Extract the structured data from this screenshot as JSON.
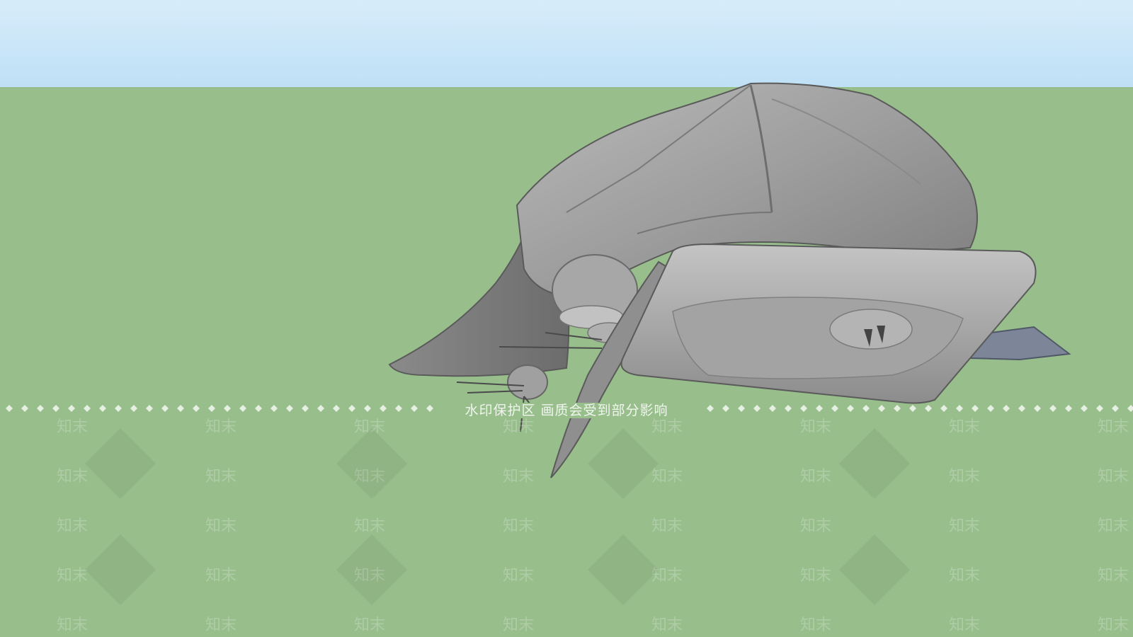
{
  "scene": {
    "sky_color": "#cfe8f8",
    "ground_color": "#98be8c",
    "model_color": "#9a9a9a"
  },
  "watermark": {
    "notice": "水印保护区 画质会受到部分影响",
    "tile_text": "知末"
  }
}
